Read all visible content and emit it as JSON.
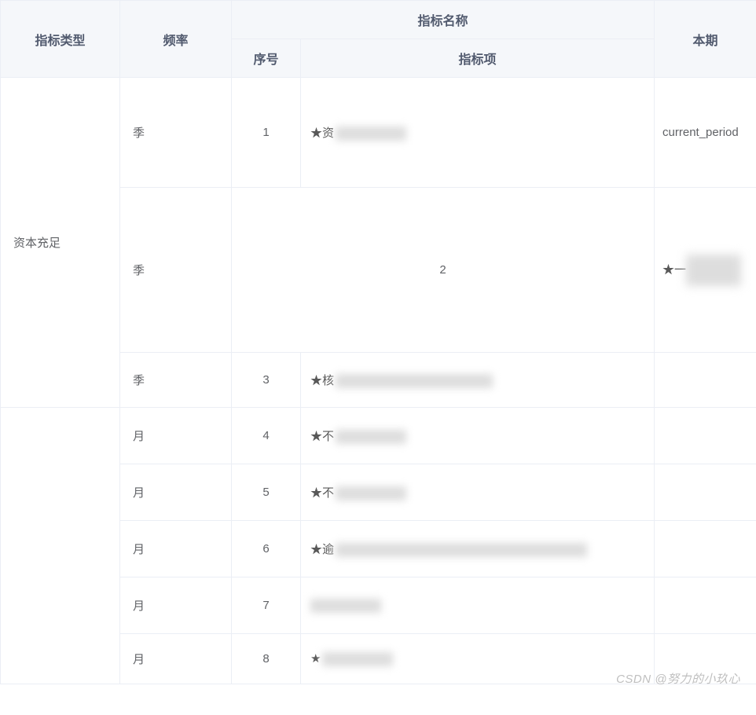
{
  "headers": {
    "type": "指标类型",
    "frequency": "频率",
    "indicatorName": "指标名称",
    "seq": "序号",
    "item": "指标项",
    "current": "本期"
  },
  "typeGroup": {
    "label": "资本充足"
  },
  "rows": [
    {
      "freq": "季",
      "seq": "1",
      "itemPrefix": "★资",
      "current": "current_period"
    },
    {
      "freq": "季",
      "seq": "2",
      "itemPrefix": "",
      "currentPrefix": "★一"
    },
    {
      "freq": "季",
      "seq": "3",
      "itemPrefix": "★核",
      "current": ""
    },
    {
      "freq": "月",
      "seq": "4",
      "itemPrefix": "★不",
      "current": ""
    },
    {
      "freq": "月",
      "seq": "5",
      "itemPrefix": "★不",
      "current": ""
    },
    {
      "freq": "月",
      "seq": "6",
      "itemPrefix": "★逾",
      "current": ""
    },
    {
      "freq": "月",
      "seq": "7",
      "itemPrefix": "",
      "current": ""
    },
    {
      "freq": "月",
      "seq": "8",
      "itemPrefix": "★",
      "current": ""
    }
  ],
  "watermark": "CSDN @努力的小玖心"
}
